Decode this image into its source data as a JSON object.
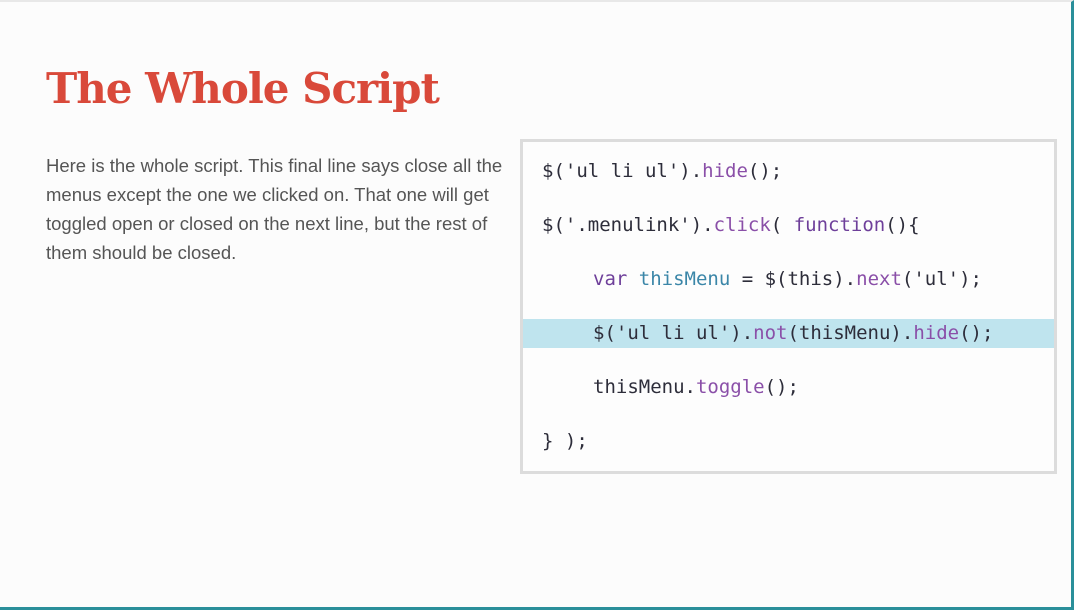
{
  "slide": {
    "title": "The Whole Script",
    "description": "Here is the whole script. This final line says close all the menus except the one we clicked on. That one will get toggled open or closed on the next line, but the rest of them should be closed."
  },
  "code": {
    "highlight_color": "#bfe4ee",
    "lines": [
      {
        "indent": 0,
        "highlighted": false,
        "tokens": [
          {
            "text": "$('ul li ul').",
            "cls": "tok-str"
          },
          {
            "text": "hide",
            "cls": "tok-method"
          },
          {
            "text": "();",
            "cls": "tok-str"
          }
        ]
      },
      {
        "indent": 0,
        "highlighted": false,
        "tokens": [
          {
            "text": "$('.menulink').",
            "cls": "tok-str"
          },
          {
            "text": "click",
            "cls": "tok-method"
          },
          {
            "text": "( ",
            "cls": "tok-str"
          },
          {
            "text": "function",
            "cls": "tok-kw"
          },
          {
            "text": "(){",
            "cls": "tok-str"
          }
        ]
      },
      {
        "indent": 1,
        "highlighted": false,
        "tokens": [
          {
            "text": "var ",
            "cls": "tok-kw"
          },
          {
            "text": "thisMenu",
            "cls": "tok-var"
          },
          {
            "text": " = $(this).",
            "cls": "tok-str"
          },
          {
            "text": "next",
            "cls": "tok-method"
          },
          {
            "text": "('ul');",
            "cls": "tok-str"
          }
        ]
      },
      {
        "indent": 1,
        "highlighted": true,
        "tokens": [
          {
            "text": "$('ul li ul').",
            "cls": "tok-str"
          },
          {
            "text": "not",
            "cls": "tok-method"
          },
          {
            "text": "(thisMenu).",
            "cls": "tok-str"
          },
          {
            "text": "hide",
            "cls": "tok-method"
          },
          {
            "text": "();",
            "cls": "tok-str"
          }
        ]
      },
      {
        "indent": 1,
        "highlighted": false,
        "tokens": [
          {
            "text": "thisMenu.",
            "cls": "tok-str"
          },
          {
            "text": "toggle",
            "cls": "tok-method"
          },
          {
            "text": "();",
            "cls": "tok-str"
          }
        ]
      },
      {
        "indent": 0,
        "highlighted": false,
        "tokens": [
          {
            "text": "} );",
            "cls": "tok-str"
          }
        ]
      }
    ]
  }
}
